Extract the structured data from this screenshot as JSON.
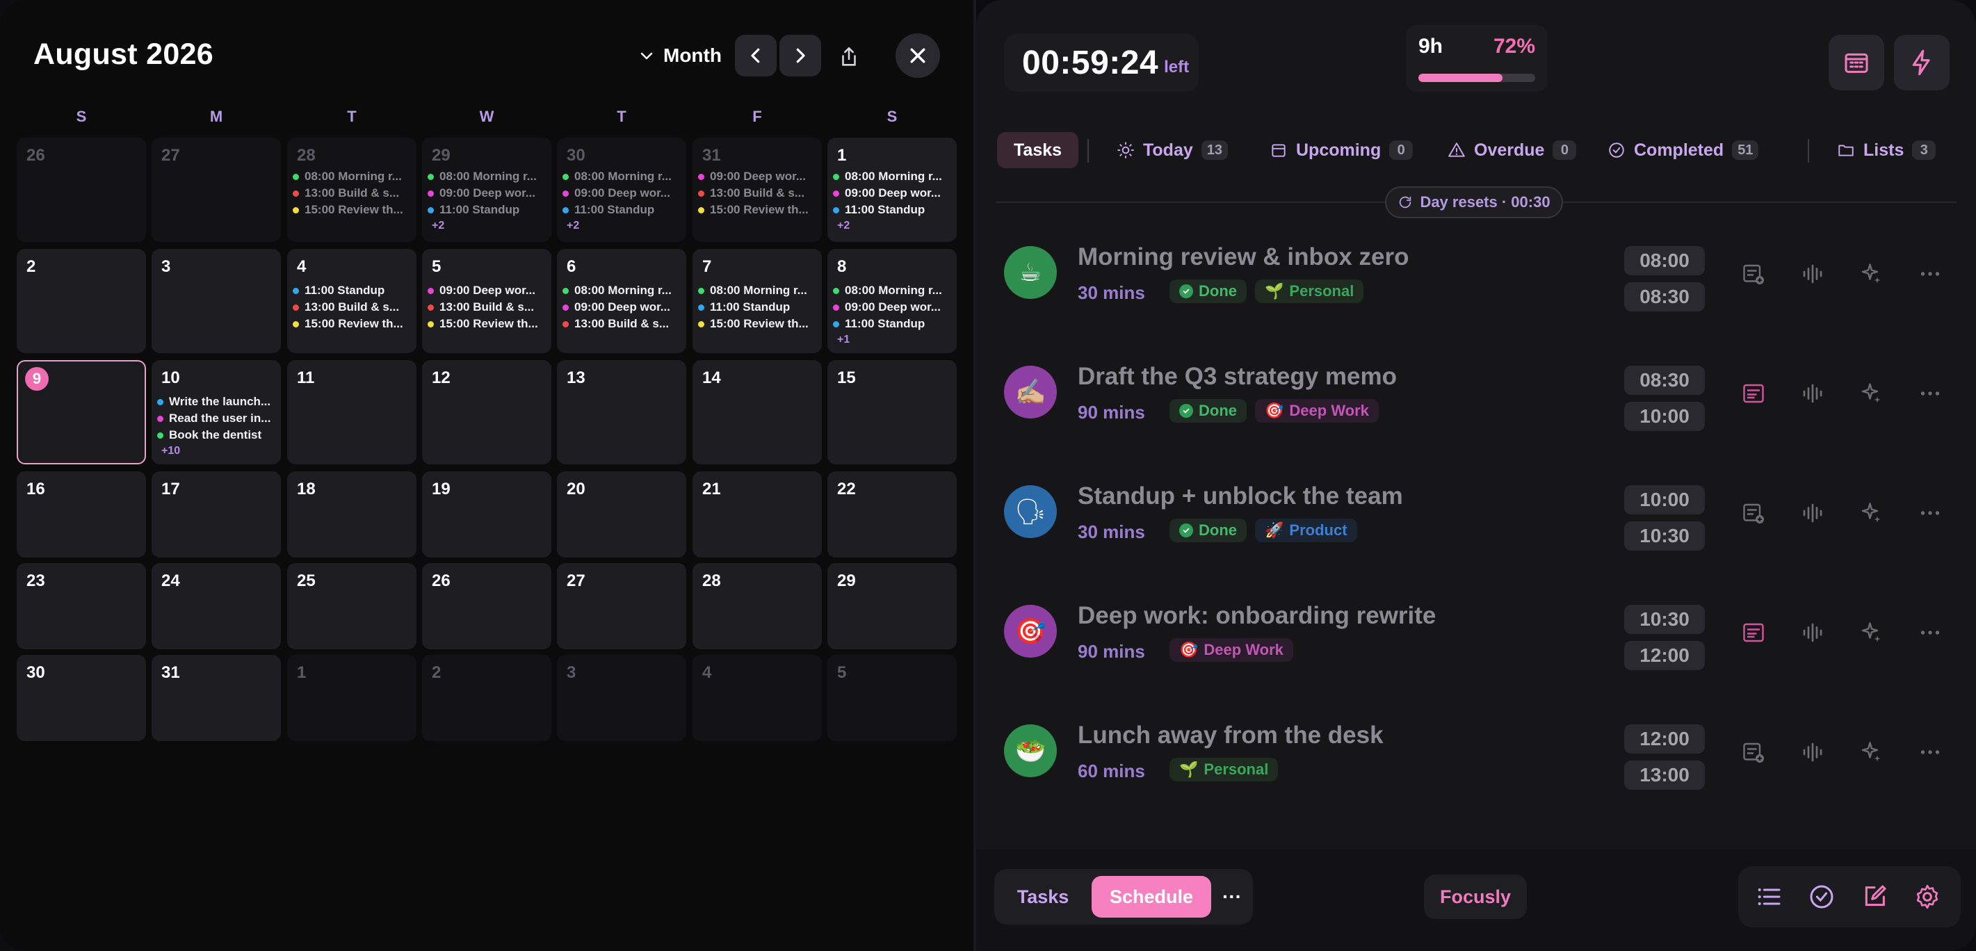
{
  "calendar": {
    "title": "August 2026",
    "view_label": "Month",
    "weekdays": [
      "S",
      "M",
      "T",
      "W",
      "T",
      "F",
      "S"
    ],
    "weeks": [
      [
        {
          "day": "26",
          "dim": true,
          "events": []
        },
        {
          "day": "27",
          "dim": true,
          "events": []
        },
        {
          "day": "28",
          "dim": true,
          "events": [
            {
              "label": "08:00 Morning r...",
              "color": "#3ddc6b"
            },
            {
              "label": "13:00 Build & s...",
              "color": "#ef4b4b"
            },
            {
              "label": "15:00 Review th...",
              "color": "#f5e03a"
            }
          ]
        },
        {
          "day": "29",
          "dim": true,
          "events": [
            {
              "label": "08:00 Morning r...",
              "color": "#3ddc6b"
            },
            {
              "label": "09:00 Deep wor...",
              "color": "#e645d8"
            },
            {
              "label": "11:00 Standup",
              "color": "#2fa8f0"
            }
          ],
          "more": "+2"
        },
        {
          "day": "30",
          "dim": true,
          "events": [
            {
              "label": "08:00 Morning r...",
              "color": "#3ddc6b"
            },
            {
              "label": "09:00 Deep wor...",
              "color": "#e645d8"
            },
            {
              "label": "11:00 Standup",
              "color": "#2fa8f0"
            }
          ],
          "more": "+2"
        },
        {
          "day": "31",
          "dim": true,
          "events": [
            {
              "label": "09:00 Deep wor...",
              "color": "#e645d8"
            },
            {
              "label": "13:00 Build & s...",
              "color": "#ef4b4b"
            },
            {
              "label": "15:00 Review th...",
              "color": "#f5e03a"
            }
          ]
        },
        {
          "day": "1",
          "dim": false,
          "events": [
            {
              "label": "08:00 Morning r...",
              "color": "#3ddc6b"
            },
            {
              "label": "09:00 Deep wor...",
              "color": "#e645d8"
            },
            {
              "label": "11:00 Standup",
              "color": "#2fa8f0"
            }
          ],
          "more": "+2"
        }
      ],
      [
        {
          "day": "2",
          "events": []
        },
        {
          "day": "3",
          "events": []
        },
        {
          "day": "4",
          "events": [
            {
              "label": "11:00 Standup",
              "color": "#2fa8f0"
            },
            {
              "label": "13:00 Build & s...",
              "color": "#ef4b4b"
            },
            {
              "label": "15:00 Review th...",
              "color": "#f5e03a"
            }
          ]
        },
        {
          "day": "5",
          "events": [
            {
              "label": "09:00 Deep wor...",
              "color": "#e645d8"
            },
            {
              "label": "13:00 Build & s...",
              "color": "#ef4b4b"
            },
            {
              "label": "15:00 Review th...",
              "color": "#f5e03a"
            }
          ]
        },
        {
          "day": "6",
          "events": [
            {
              "label": "08:00 Morning r...",
              "color": "#3ddc6b"
            },
            {
              "label": "09:00 Deep wor...",
              "color": "#e645d8"
            },
            {
              "label": "13:00 Build & s...",
              "color": "#ef4b4b"
            }
          ]
        },
        {
          "day": "7",
          "events": [
            {
              "label": "08:00 Morning r...",
              "color": "#3ddc6b"
            },
            {
              "label": "11:00 Standup",
              "color": "#2fa8f0"
            },
            {
              "label": "15:00 Review th...",
              "color": "#f5e03a"
            }
          ]
        },
        {
          "day": "8",
          "events": [
            {
              "label": "08:00 Morning r...",
              "color": "#3ddc6b"
            },
            {
              "label": "09:00 Deep wor...",
              "color": "#e645d8"
            },
            {
              "label": "11:00 Standup",
              "color": "#2fa8f0"
            }
          ],
          "more": "+1"
        }
      ],
      [
        {
          "day": "9",
          "today": true,
          "events": []
        },
        {
          "day": "10",
          "events": [
            {
              "label": "Write the launch...",
              "color": "#2fa8f0"
            },
            {
              "label": "Read the user in...",
              "color": "#e645d8"
            },
            {
              "label": "Book the dentist",
              "color": "#3ddc6b"
            }
          ],
          "more": "+10"
        },
        {
          "day": "11",
          "events": []
        },
        {
          "day": "12",
          "events": []
        },
        {
          "day": "13",
          "events": []
        },
        {
          "day": "14",
          "events": []
        },
        {
          "day": "15",
          "events": []
        }
      ],
      [
        {
          "day": "16",
          "events": []
        },
        {
          "day": "17",
          "events": []
        },
        {
          "day": "18",
          "events": []
        },
        {
          "day": "19",
          "events": []
        },
        {
          "day": "20",
          "events": []
        },
        {
          "day": "21",
          "events": []
        },
        {
          "day": "22",
          "events": []
        }
      ],
      [
        {
          "day": "23",
          "events": []
        },
        {
          "day": "24",
          "events": []
        },
        {
          "day": "25",
          "events": []
        },
        {
          "day": "26",
          "events": []
        },
        {
          "day": "27",
          "events": []
        },
        {
          "day": "28",
          "events": []
        },
        {
          "day": "29",
          "events": []
        }
      ],
      [
        {
          "day": "30",
          "events": []
        },
        {
          "day": "31",
          "events": []
        },
        {
          "day": "1",
          "dim": true,
          "events": []
        },
        {
          "day": "2",
          "dim": true,
          "events": []
        },
        {
          "day": "3",
          "dim": true,
          "events": []
        },
        {
          "day": "4",
          "dim": true,
          "events": []
        },
        {
          "day": "5",
          "dim": true,
          "events": []
        }
      ]
    ]
  },
  "header": {
    "timer": "00:59:24",
    "timer_suffix": "left",
    "planned_hours": "9h",
    "percent_label": "72%",
    "progress": 0.72,
    "calendar_button_icon": "calendar-icon",
    "quick_button_icon": "lightning-icon"
  },
  "filters": {
    "tasks": "Tasks",
    "today": {
      "label": "Today",
      "count": "13"
    },
    "upcoming": {
      "label": "Upcoming",
      "count": "0"
    },
    "overdue": {
      "label": "Overdue",
      "count": "0"
    },
    "completed": {
      "label": "Completed",
      "count": "51"
    },
    "lists": {
      "label": "Lists",
      "count": "3"
    }
  },
  "reset_label": "Day resets · 00:30",
  "tasks": [
    {
      "emoji": "☕",
      "avatar_color": "#2f8f4e",
      "title": "Morning review & inbox zero",
      "duration": "30 mins",
      "status": "Done",
      "tag": "Personal",
      "tag_emoji": "🌱",
      "tag_type": "personal",
      "start": "08:00",
      "end": "08:30",
      "note_icon": "note-add-icon"
    },
    {
      "emoji": "✍🏼",
      "avatar_color": "#8e3fa3",
      "title": "Draft the Q3 strategy memo",
      "duration": "90 mins",
      "status": "Done",
      "tag": "Deep Work",
      "tag_emoji": "🎯",
      "tag_type": "deepwork",
      "start": "08:30",
      "end": "10:00",
      "note_icon": "note-icon"
    },
    {
      "emoji": "🗣",
      "avatar_color": "#2a6aa8",
      "title": "Standup + unblock the team",
      "duration": "30 mins",
      "status": "Done",
      "tag": "Product",
      "tag_emoji": "🚀",
      "tag_type": "product",
      "start": "10:00",
      "end": "10:30",
      "note_icon": "note-add-icon"
    },
    {
      "emoji": "🎯",
      "avatar_color": "#8e3fa3",
      "title": "Deep work: onboarding rewrite",
      "duration": "90 mins",
      "status": "",
      "tag": "Deep Work",
      "tag_emoji": "🎯",
      "tag_type": "deepwork",
      "start": "10:30",
      "end": "12:00",
      "note_icon": "note-icon"
    },
    {
      "emoji": "🥗",
      "avatar_color": "#2f8f4e",
      "title": "Lunch away from the desk",
      "duration": "60 mins",
      "status": "",
      "tag": "Personal",
      "tag_emoji": "🌱",
      "tag_type": "personal",
      "start": "12:00",
      "end": "13:00",
      "note_icon": "note-add-icon"
    }
  ],
  "bottom": {
    "tab_tasks": "Tasks",
    "tab_schedule": "Schedule",
    "more": "···",
    "brand": "Focusly",
    "icons": [
      "list-icon",
      "check-circle-icon",
      "edit-icon",
      "settings-icon"
    ]
  }
}
